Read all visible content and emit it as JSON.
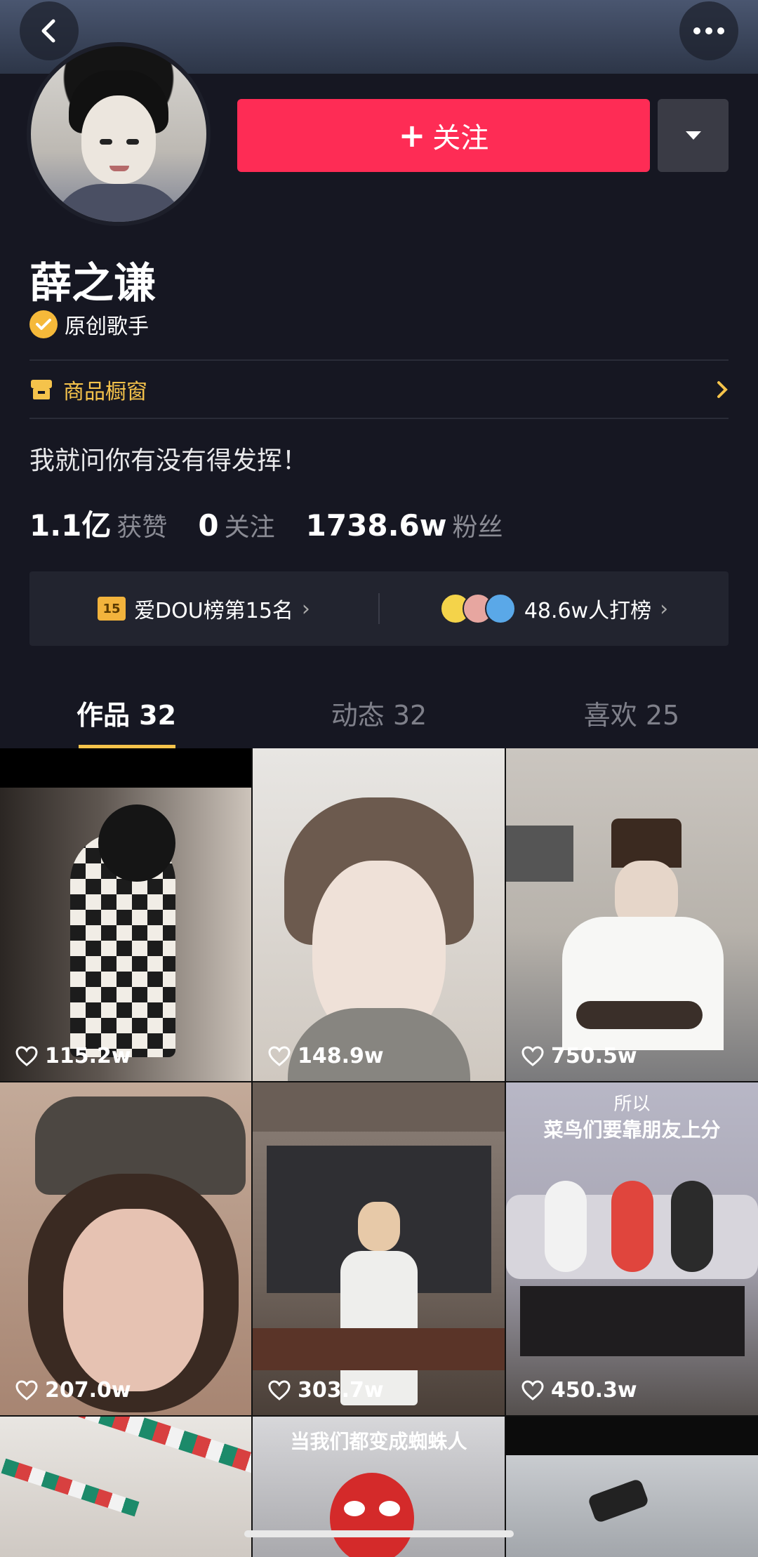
{
  "header": {
    "back_icon": "chevron-left-icon",
    "more_icon": "more-dots-icon"
  },
  "profile": {
    "name": "薛之谦",
    "verified_label": "原创歌手",
    "follow_label": "关注",
    "bio": "我就问你有没有得发挥！"
  },
  "shop": {
    "label": "商品橱窗"
  },
  "stats": {
    "likes": {
      "value": "1.1亿",
      "label": "获赞"
    },
    "following": {
      "value": "0",
      "label": "关注"
    },
    "fans": {
      "value": "1738.6w",
      "label": "粉丝"
    }
  },
  "ranking": {
    "badge": "15",
    "rank_text": "爱DOU榜第15名",
    "supporters_text": "48.6w人打榜"
  },
  "tabs": [
    {
      "label": "作品 32",
      "active": true
    },
    {
      "label": "动态 32",
      "active": false
    },
    {
      "label": "喜欢 25",
      "active": false
    }
  ],
  "videos": [
    {
      "likes": "115.2w"
    },
    {
      "likes": "148.9w"
    },
    {
      "likes": "750.5w"
    },
    {
      "likes": "207.0w"
    },
    {
      "likes": "303.7w"
    },
    {
      "likes": "450.3w",
      "caption_top": "所以",
      "caption": "菜鸟们要靠朋友上分"
    },
    {
      "likes": "",
      "caption": ""
    },
    {
      "likes": "",
      "caption": "当我们都变成蜘蛛人"
    },
    {
      "likes": ""
    }
  ],
  "colors": {
    "accent": "#fe2c55",
    "gold": "#f5c34b",
    "background": "#161722"
  }
}
